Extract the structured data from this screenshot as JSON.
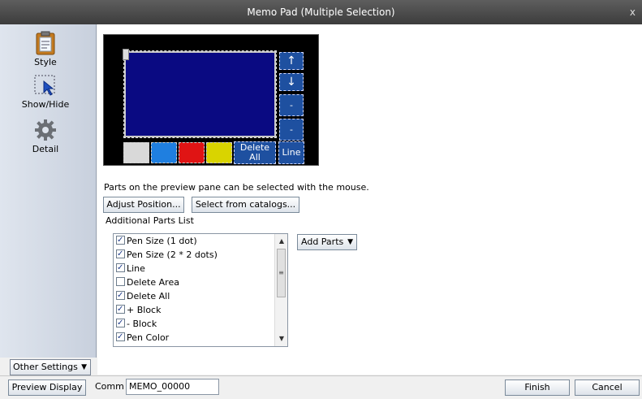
{
  "window": {
    "title": "Memo Pad (Multiple Selection)",
    "close_label": "x"
  },
  "sidebar": {
    "items": [
      {
        "label": "Style",
        "icon": "clipboard-style-icon"
      },
      {
        "label": "Show/Hide",
        "icon": "dotted-cursor-icon"
      },
      {
        "label": "Detail",
        "icon": "gear-icon"
      }
    ],
    "other_settings_label": "Other Settings"
  },
  "preview": {
    "buttons": {
      "up_arrow": "↑",
      "down_arrow": "↓",
      "plus_block": "-",
      "minus_block": "-",
      "delete_all": "Delete All",
      "line": "Line"
    },
    "color_buttons": [
      "#d9d9d9",
      "#1f7fe0",
      "#e01414",
      "#d9d400"
    ]
  },
  "main": {
    "hint": "Parts on the preview pane can be selected with the mouse.",
    "adjust_position_label": "Adjust Position...",
    "select_catalog_label": "Select from catalogs...",
    "additional_parts_label": "Additional Parts List",
    "add_parts_label": "Add Parts",
    "parts_list": [
      {
        "label": "Pen Size (1 dot)",
        "checked": true
      },
      {
        "label": "Pen Size (2 * 2 dots)",
        "checked": true
      },
      {
        "label": "Line",
        "checked": true
      },
      {
        "label": "Delete Area",
        "checked": false
      },
      {
        "label": "Delete All",
        "checked": true
      },
      {
        "label": "+ Block",
        "checked": true
      },
      {
        "label": "- Block",
        "checked": true
      },
      {
        "label": "Pen Color",
        "checked": true
      }
    ]
  },
  "footer": {
    "preview_display_label": "Preview Display",
    "comm_label": "Comm",
    "comm_value": "MEMO_00000",
    "finish_label": "Finish",
    "cancel_label": "Cancel"
  }
}
